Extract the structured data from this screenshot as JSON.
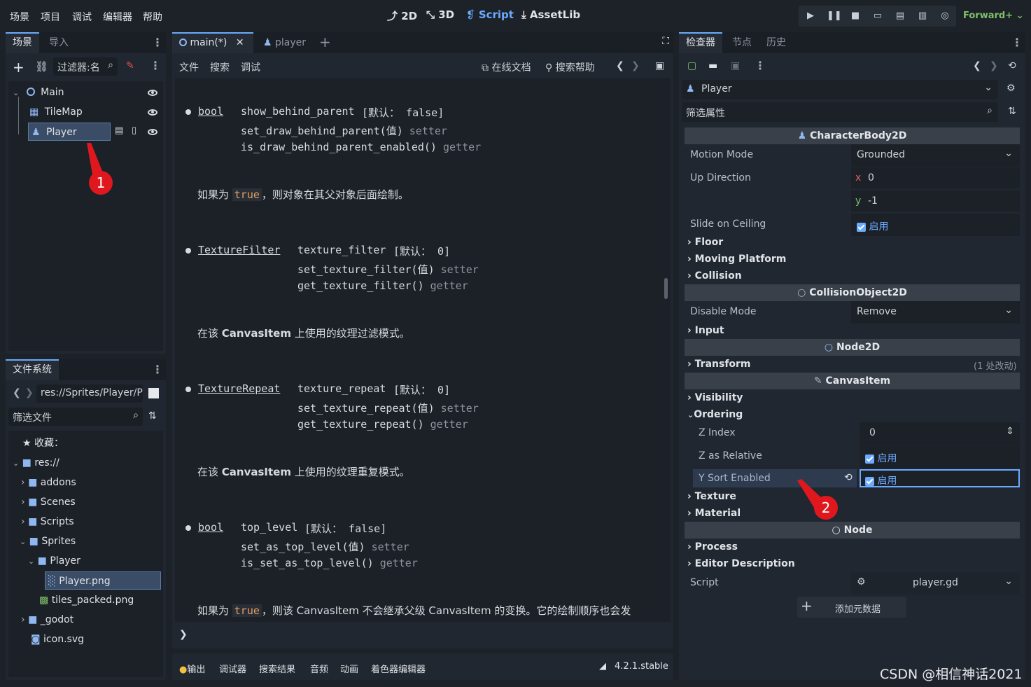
{
  "menu": [
    "场景",
    "项目",
    "调试",
    "编辑器",
    "帮助"
  ],
  "workspaces": [
    "2D",
    "3D",
    "Script",
    "AssetLib"
  ],
  "renderer": "Forward+",
  "scene_dock": {
    "tabs": [
      "场景",
      "导入"
    ],
    "filter_placeholder": "过滤器:名",
    "nodes": [
      {
        "name": "Main"
      },
      {
        "name": "TileMap"
      },
      {
        "name": "Player"
      }
    ],
    "annotation": "1"
  },
  "filesystem_dock": {
    "tab": "文件系统",
    "path": "res://Sprites/Player/P",
    "filter_placeholder": "筛选文件",
    "items": [
      "收藏：",
      "res://",
      "addons",
      "Scenes",
      "Scripts",
      "Sprites",
      "Player",
      "Player.png",
      "tiles_packed.png",
      "_godot",
      "icon.svg"
    ]
  },
  "script_editor": {
    "tabs": [
      "main(*)",
      "player"
    ],
    "menu": [
      "文件",
      "搜索",
      "调试"
    ],
    "toolbar": [
      "在线文档",
      "搜索帮助"
    ],
    "props": [
      {
        "type": "bool",
        "name": "show_behind_parent",
        "default": "[默认： false]",
        "setter": "set_draw_behind_parent(值)",
        "getter": "is_draw_behind_parent_enabled()",
        "desc_pre": "如果为 ",
        "desc_kw": "true",
        "desc_post": "，则对象在其父对象后面绘制。"
      },
      {
        "type": "TextureFilter",
        "name": "texture_filter",
        "default": "[默认： 0]",
        "setter": "set_texture_filter(值)",
        "getter": "get_texture_filter()",
        "desc_pre": "在该 ",
        "desc_kw": "CanvasItem",
        "desc_post": " 上使用的纹理过滤模式。"
      },
      {
        "type": "TextureRepeat",
        "name": "texture_repeat",
        "default": "[默认： 0]",
        "setter": "set_texture_repeat(值)",
        "getter": "get_texture_repeat()",
        "desc_pre": "在该 ",
        "desc_kw": "CanvasItem",
        "desc_post": " 上使用的纹理重复模式。"
      },
      {
        "type": "bool",
        "name": "top_level",
        "default": "[默认： false]",
        "setter": "set_as_top_level(值)",
        "getter": "is_set_as_top_level()",
        "desc_pre": "如果为 ",
        "desc_kw": "true",
        "desc_post": "，则该 CanvasItem 不会继承父级 CanvasItem 的变换。它的绘制顺序也会发"
      }
    ],
    "setter_word": "setter",
    "getter_word": "getter"
  },
  "bottom_panel": {
    "tabs": [
      "输出",
      "调试器",
      "搜索结果",
      "音频",
      "动画",
      "着色器编辑器"
    ],
    "version": "4.2.1.stable"
  },
  "inspector": {
    "tabs": [
      "检查器",
      "节点",
      "历史"
    ],
    "object": "Player",
    "filter_placeholder": "筛选属性",
    "sections": {
      "characterbody": "CharacterBody2D",
      "collisionobject": "CollisionObject2D",
      "node2d": "Node2D",
      "canvasitem": "CanvasItem",
      "node": "Node"
    },
    "motion_mode": {
      "label": "Motion Mode",
      "value": "Grounded"
    },
    "up_direction": {
      "label": "Up Direction",
      "x": "0",
      "y": "-1"
    },
    "slide_on_ceiling": {
      "label": "Slide on Ceiling",
      "value": "启用"
    },
    "groups1": [
      "Floor",
      "Moving Platform",
      "Collision"
    ],
    "disable_mode": {
      "label": "Disable Mode",
      "value": "Remove"
    },
    "input": "Input",
    "transform": {
      "label": "Transform",
      "note": "(1 处改动)"
    },
    "visibility": "Visibility",
    "ordering": "Ordering",
    "z_index": {
      "label": "Z Index",
      "value": "0"
    },
    "z_as_relative": {
      "label": "Z as Relative",
      "value": "启用"
    },
    "y_sort": {
      "label": "Y Sort Enabled",
      "value": "启用"
    },
    "groups2": [
      "Texture",
      "Material"
    ],
    "groups3": [
      "Process",
      "Editor Description"
    ],
    "script": {
      "label": "Script",
      "value": "player.gd"
    },
    "add_metadata": "添加元数据",
    "annotation": "2"
  },
  "watermark": "CSDN @相信神话2021",
  "colors": {
    "accent": "#6aaaff",
    "badge": "#e0181e",
    "background": "#1d2229"
  }
}
